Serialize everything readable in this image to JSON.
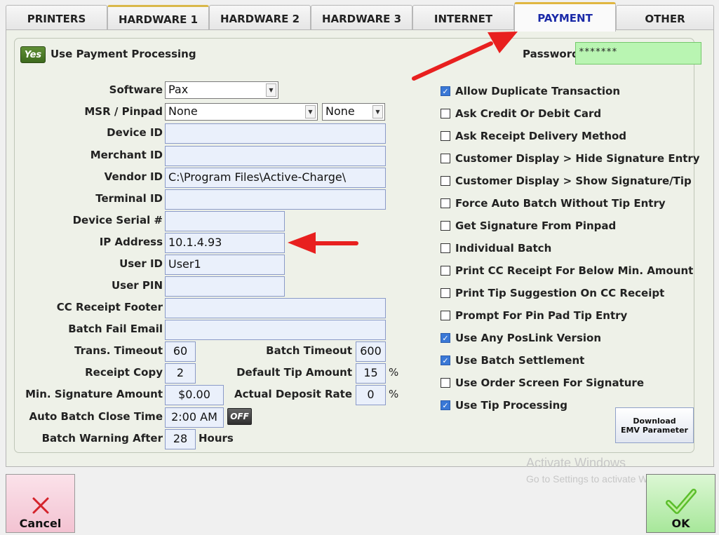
{
  "tabs": [
    "PRINTERS",
    "HARDWARE 1",
    "HARDWARE 2",
    "HARDWARE 3",
    "INTERNET",
    "PAYMENT",
    "OTHER"
  ],
  "active_tab": "PAYMENT",
  "use_payment": {
    "badge": "Yes",
    "label": "Use Payment Processing"
  },
  "password": {
    "label": "Password",
    "value": "*******"
  },
  "fields": {
    "software": {
      "label": "Software",
      "value": "Pax"
    },
    "msr": {
      "label": "MSR / Pinpad",
      "value": "None",
      "value2": "None"
    },
    "device_id": {
      "label": "Device ID",
      "value": ""
    },
    "merchant_id": {
      "label": "Merchant ID",
      "value": ""
    },
    "vendor_id": {
      "label": "Vendor ID",
      "value": "C:\\Program Files\\Active-Charge\\"
    },
    "terminal_id": {
      "label": "Terminal ID",
      "value": ""
    },
    "device_serial": {
      "label": "Device Serial #",
      "value": ""
    },
    "ip_address": {
      "label": "IP Address",
      "value": "10.1.4.93"
    },
    "user_id": {
      "label": "User ID",
      "value": "User1"
    },
    "user_pin": {
      "label": "User PIN",
      "value": ""
    },
    "cc_footer": {
      "label": "CC Receipt Footer",
      "value": ""
    },
    "batch_fail_email": {
      "label": "Batch Fail Email",
      "value": ""
    },
    "trans_timeout": {
      "label": "Trans. Timeout",
      "value": "60"
    },
    "batch_timeout": {
      "label": "Batch Timeout",
      "value": "600"
    },
    "receipt_copy": {
      "label": "Receipt Copy",
      "value": "2"
    },
    "default_tip": {
      "label": "Default Tip Amount",
      "value": "15",
      "unit": "%"
    },
    "min_signature": {
      "label": "Min. Signature Amount",
      "value": "$0.00"
    },
    "deposit_rate": {
      "label": "Actual Deposit Rate",
      "value": "0",
      "unit": "%"
    },
    "auto_batch": {
      "label": "Auto Batch Close Time",
      "value": "2:00 AM",
      "toggle": "OFF"
    },
    "batch_warning": {
      "label": "Batch Warning After",
      "value": "28",
      "unit": "Hours"
    }
  },
  "options": [
    {
      "label": "Allow Duplicate Transaction",
      "checked": true
    },
    {
      "label": "Ask Credit Or Debit Card",
      "checked": false
    },
    {
      "label": "Ask Receipt Delivery Method",
      "checked": false
    },
    {
      "label": "Customer Display > Hide Signature Entry",
      "checked": false
    },
    {
      "label": "Customer Display > Show Signature/Tip",
      "checked": false
    },
    {
      "label": "Force Auto Batch Without Tip Entry",
      "checked": false
    },
    {
      "label": "Get Signature From Pinpad",
      "checked": false
    },
    {
      "label": "Individual Batch",
      "checked": false
    },
    {
      "label": "Print CC Receipt For Below Min. Amount",
      "checked": false
    },
    {
      "label": "Print Tip Suggestion On CC Receipt",
      "checked": false
    },
    {
      "label": "Prompt For Pin Pad Tip Entry",
      "checked": false
    },
    {
      "label": "Use Any PosLink Version",
      "checked": true
    },
    {
      "label": "Use Batch Settlement",
      "checked": true
    },
    {
      "label": "Use Order Screen For Signature",
      "checked": false
    },
    {
      "label": "Use Tip Processing",
      "checked": true
    }
  ],
  "emv_button": {
    "line1": "Download",
    "line2": "EMV Parameter"
  },
  "buttons": {
    "cancel": "Cancel",
    "ok": "OK"
  },
  "watermark": {
    "line1": "Activate Windows",
    "line2": "Go to Settings to activate Windows."
  },
  "colors": {
    "active_tab_text": "#1b2aa8",
    "password_bg": "#b9f5b2",
    "annotation_arrow": "#e8201f",
    "checkbox_checked": "#3a78d6"
  },
  "annotations": [
    "red-arrow-to-payment-tab",
    "red-arrow-to-ip-address"
  ]
}
